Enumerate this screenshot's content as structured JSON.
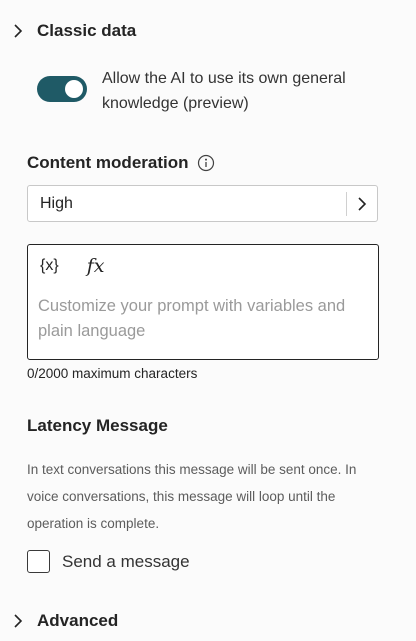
{
  "classic_data": {
    "label": "Classic data",
    "icon": "chevron-right-icon"
  },
  "toggle": {
    "state": "on",
    "label": "Allow the AI to use its own general knowledge (preview)",
    "color": "#1f5a66"
  },
  "content_moderation": {
    "label": "Content moderation",
    "icon": "info-icon",
    "value": "High"
  },
  "prompt": {
    "variable_tool": "{x}",
    "formula_tool": "fx",
    "placeholder": "Customize your prompt with variables and plain language",
    "counter": "0/2000 maximum characters"
  },
  "latency": {
    "label": "Latency Message",
    "description": "In text conversations this message will be sent once. In voice conversations, this message will loop until the operation is complete.",
    "checkbox_label": "Send a message",
    "checked": false
  },
  "advanced": {
    "label": "Advanced",
    "icon": "chevron-right-icon"
  }
}
